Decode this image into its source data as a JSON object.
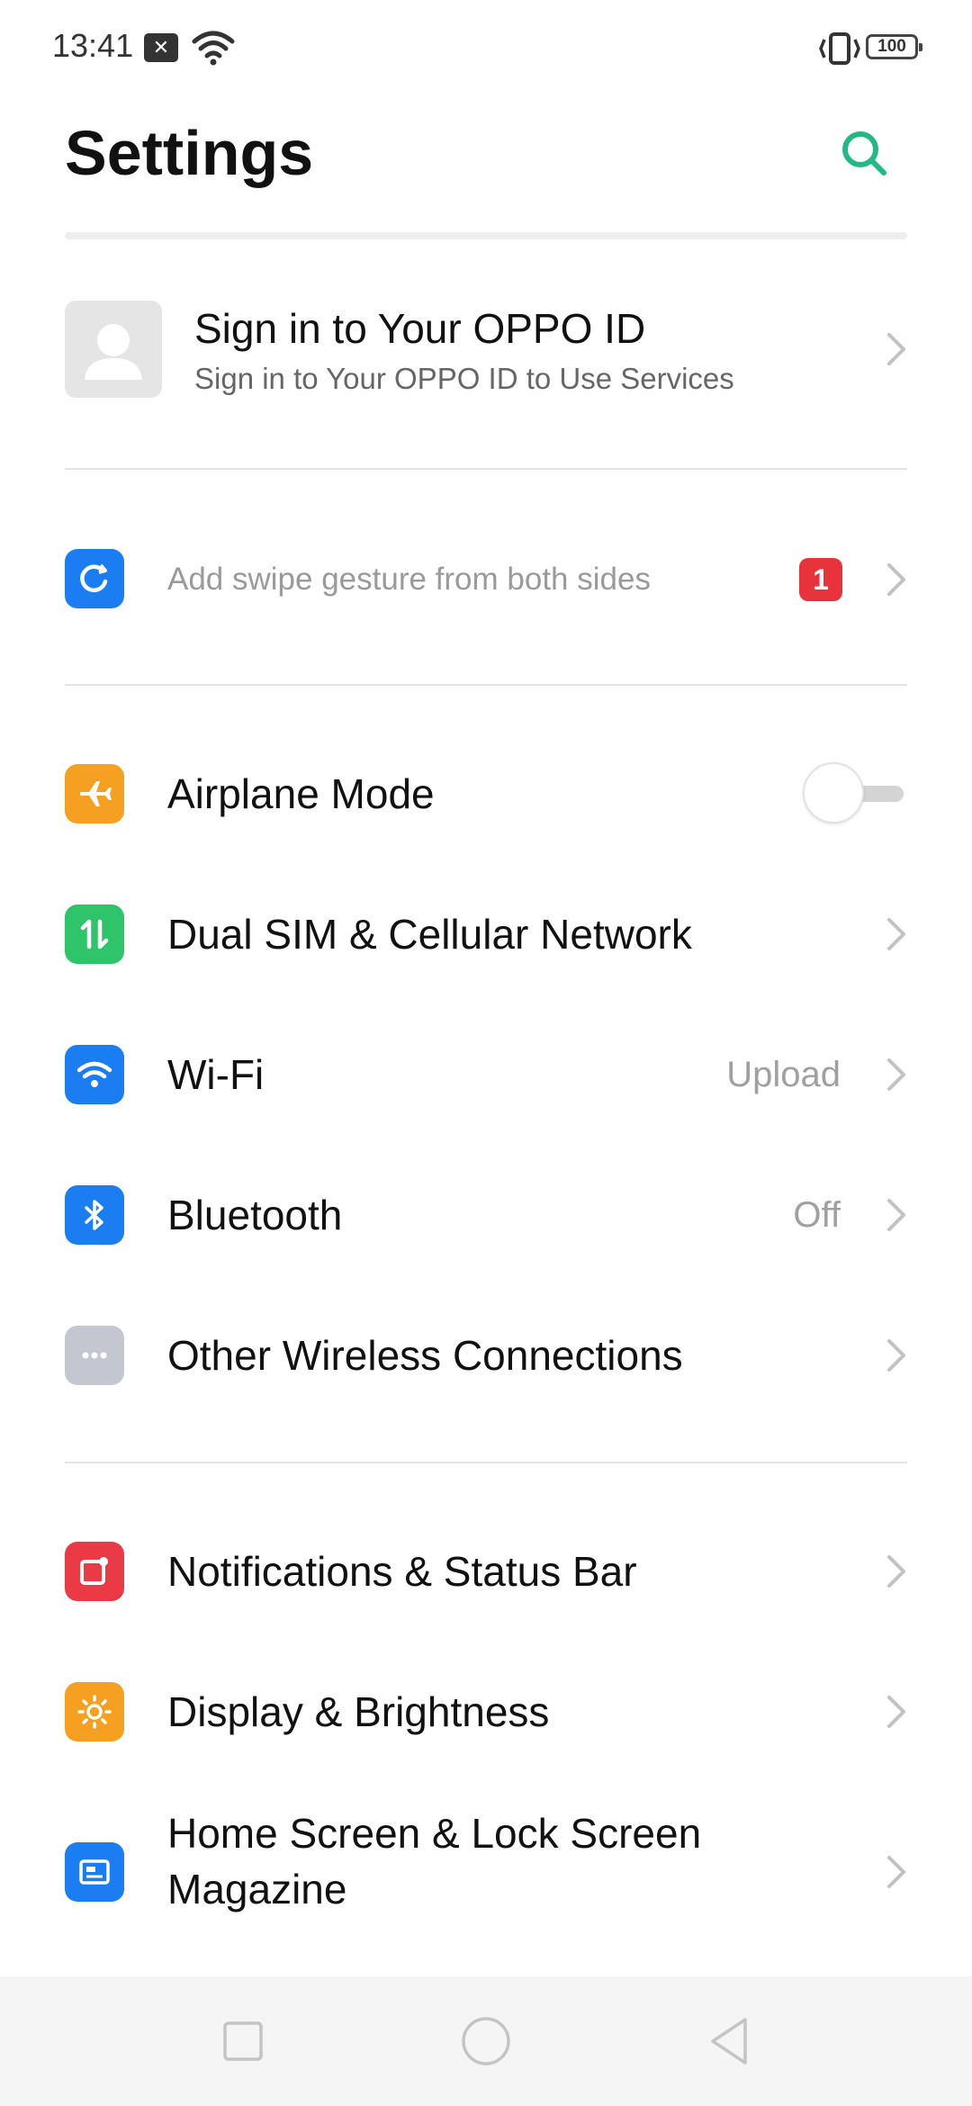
{
  "status_bar": {
    "time": "13:41",
    "battery": "100"
  },
  "header": {
    "title": "Settings"
  },
  "account": {
    "title": "Sign in to Your OPPO ID",
    "subtitle": "Sign in to Your OPPO ID to Use Services"
  },
  "hint": {
    "label": "Add swipe gesture from both sides",
    "badge": "1",
    "icon": "swipe-gesture-icon"
  },
  "connectivity": [
    {
      "label": "Airplane Mode",
      "icon": "airplane-icon",
      "color": "#f5a021",
      "toggle": false
    },
    {
      "label": "Dual SIM & Cellular Network",
      "icon": "sim-arrows-icon",
      "color": "#2ec46a"
    },
    {
      "label": "Wi-Fi",
      "value": "Upload",
      "icon": "wifi-icon",
      "color": "#1a7ef2"
    },
    {
      "label": "Bluetooth",
      "value": "Off",
      "icon": "bluetooth-icon",
      "color": "#1a7ef2"
    },
    {
      "label": "Other Wireless Connections",
      "icon": "more-dots-icon",
      "color": "#c4c7d0"
    }
  ],
  "display_group": [
    {
      "label": "Notifications & Status Bar",
      "icon": "notification-icon",
      "color": "#ea3a46"
    },
    {
      "label": "Display & Brightness",
      "icon": "brightness-icon",
      "color": "#f5a021"
    },
    {
      "label_line1": "Home Screen & Lock Screen",
      "label_line2": "Magazine",
      "icon": "wallpaper-icon",
      "color": "#1a7ef2"
    }
  ],
  "colors": {
    "accent": "#23b887",
    "badge": "#e8323c",
    "nav_bg": "#f5f5f5"
  }
}
